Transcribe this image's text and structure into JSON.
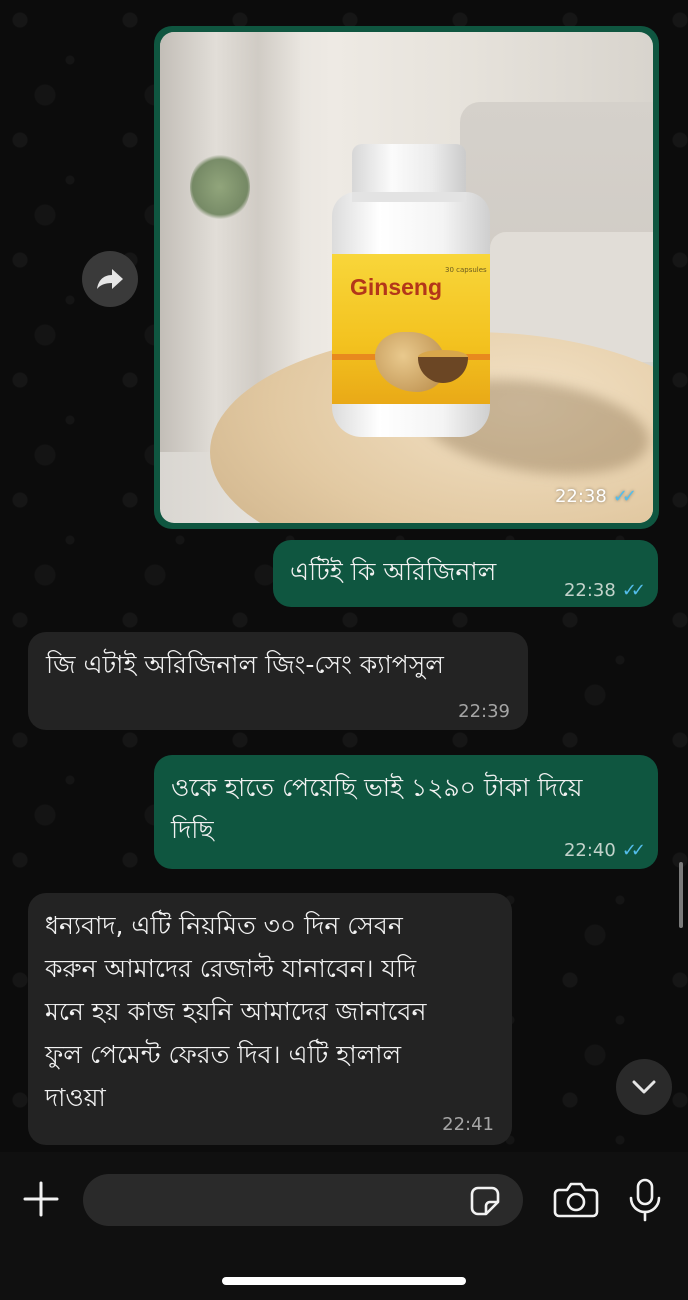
{
  "messages": [
    {
      "type": "image",
      "direction": "outgoing",
      "product_text": "Ginseng",
      "label_small": "30 capsules",
      "time": "22:38",
      "status": "read"
    },
    {
      "type": "text",
      "direction": "outgoing",
      "text": "এটিই কি অরিজিনাল",
      "time": "22:38",
      "status": "read"
    },
    {
      "type": "text",
      "direction": "incoming",
      "text": "জি এটাই অরিজিনাল জিং-সেং ক্যাপসুল",
      "time": "22:39"
    },
    {
      "type": "text",
      "direction": "outgoing",
      "lines": [
        "ওকে হাতে পেয়েছি ভাই ১২৯০ টাকা দিয়ে",
        "দিছি"
      ],
      "time": "22:40",
      "status": "read"
    },
    {
      "type": "text",
      "direction": "incoming",
      "lines": [
        "ধন্যবাদ, এটি নিয়মিত ৩০ দিন সেবন",
        "করুন আমাদের রেজাল্ট যানাবেন। যদি",
        "মনে হয় কাজ হয়নি আমাদের জানাবেন",
        "ফুল পেমেন্ট ফেরত দিব। এটি হালাল",
        "দাওয়া"
      ],
      "time": "22:41"
    }
  ],
  "icons": {
    "forward": "forward-arrow-icon",
    "scroll_down": "chevron-down-icon",
    "attach": "plus-icon",
    "sticker": "sticker-icon",
    "camera": "camera-icon",
    "mic": "microphone-icon",
    "read_receipt": "double-check-icon"
  },
  "colors": {
    "outgoing_bubble": "#0f5640",
    "incoming_bubble": "#232323",
    "read_tick": "#53bdeb",
    "background": "#0b0b0b"
  }
}
